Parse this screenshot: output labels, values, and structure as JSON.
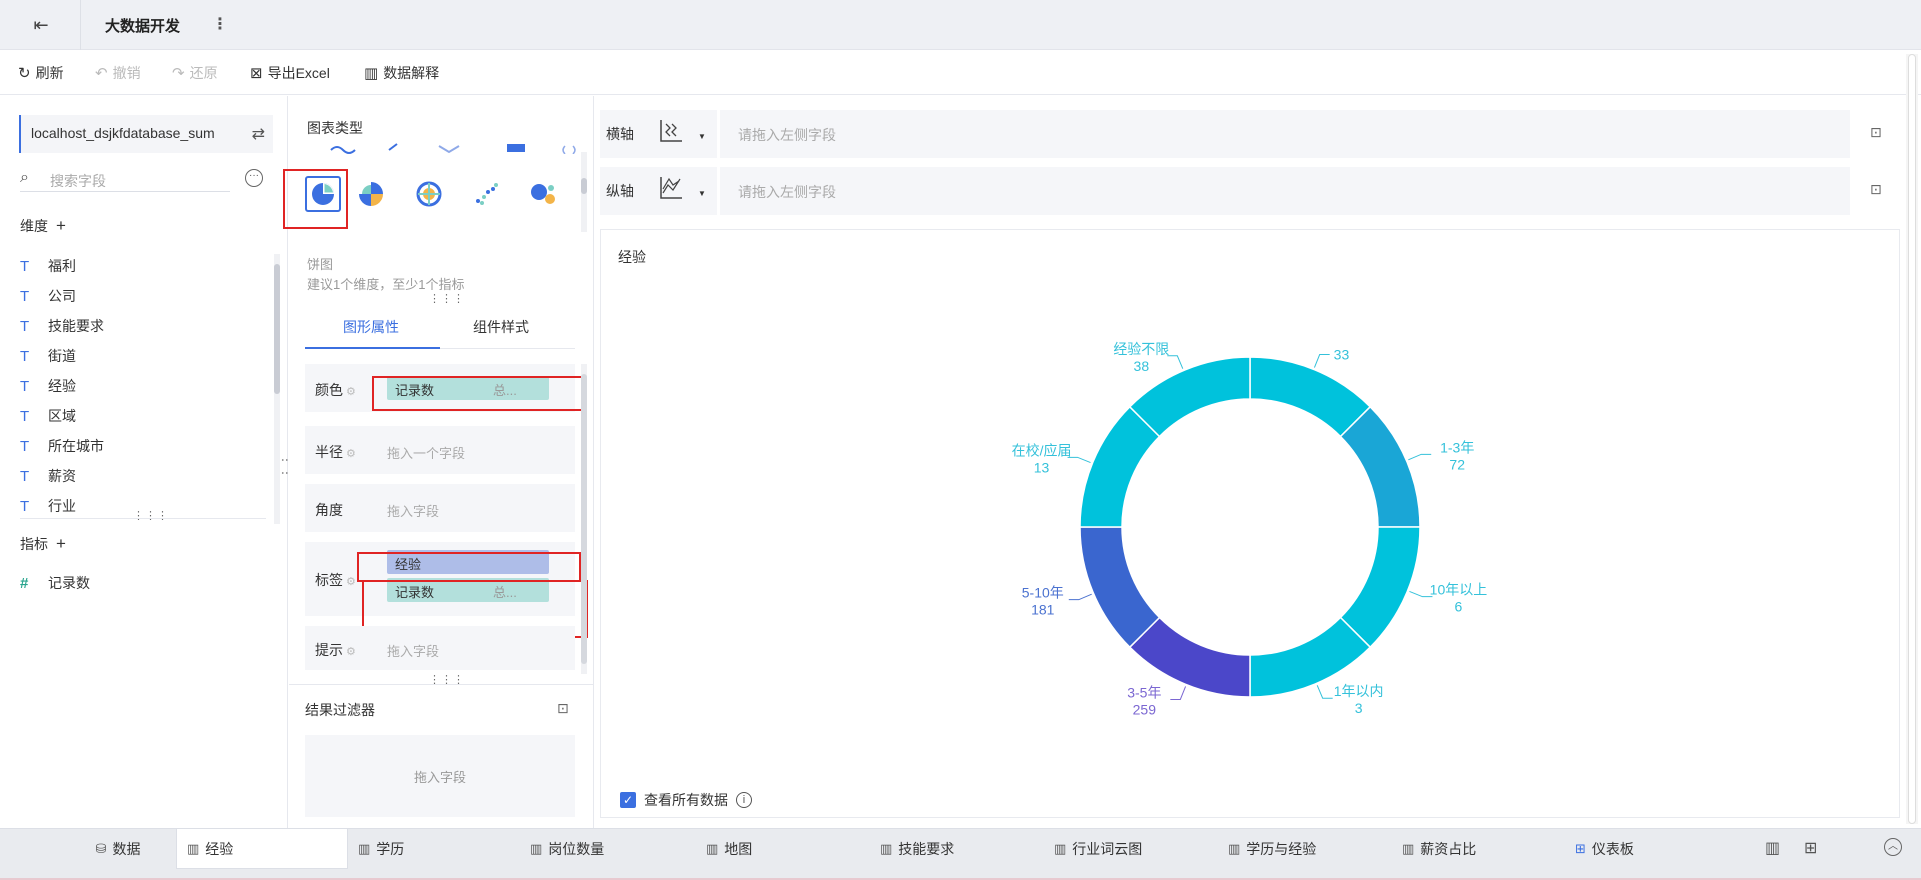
{
  "titlebar": {
    "title": "大数据开发",
    "back_icon": "exit-icon",
    "more_icon": "vertical-dots-icon"
  },
  "toolbar": {
    "refresh": "刷新",
    "undo": "撤销",
    "redo": "还原",
    "export": "导出Excel",
    "explain": "数据解释"
  },
  "left": {
    "dataset_name": "localhost_dsjkfdatabase_sum",
    "search_placeholder": "搜索字段",
    "dimensions_title": "维度",
    "dimensions": [
      "福利",
      "公司",
      "技能要求",
      "街道",
      "经验",
      "区域",
      "所在城市",
      "薪资",
      "行业"
    ],
    "measures_title": "指标",
    "measures": [
      "记录数"
    ]
  },
  "middle": {
    "chart_type_title": "图表类型",
    "chart_name": "饼图",
    "chart_hint": "建议1个维度，至少1个指标",
    "tab_graph": "图形属性",
    "tab_style": "组件样式",
    "color_label": "颜色",
    "color_field": "记录数",
    "color_agg": "总...",
    "radius_label": "半径",
    "radius_placeholder": "拖入一个字段",
    "angle_label": "角度",
    "angle_placeholder": "拖入字段",
    "label_label": "标签",
    "label_field1": "经验",
    "label_field2": "记录数",
    "label_agg": "总...",
    "tip_label": "提示",
    "tip_placeholder": "拖入字段",
    "filter_title": "结果过滤器",
    "filter_placeholder": "拖入字段"
  },
  "axes": {
    "x_label": "横轴",
    "y_label": "纵轴",
    "placeholder": "请拖入左侧字段"
  },
  "chart": {
    "title": "经验",
    "view_all": "查看所有数据"
  },
  "chart_data": {
    "type": "pie",
    "title": "经验",
    "donut": true,
    "categories": [
      "经验不限",
      "1-3年",
      "10年以上",
      "1年以内",
      "3-5年",
      "5-10年",
      "在校/应届"
    ],
    "label_values": [
      "33",
      "72",
      "6",
      "3",
      "259",
      "181",
      "13"
    ],
    "label_names": [
      "",
      "1-3年",
      "10年以上",
      "1年以内",
      "3-5年",
      "5-10年",
      "在校/应届"
    ],
    "top_label": {
      "name": "经验不限",
      "value": "38"
    },
    "segment_colors": [
      "#00c2dc",
      "#1aa6d6",
      "#00c2dc",
      "#00c2dc",
      "#4b47c9",
      "#3a66cf",
      "#00c2dc"
    ],
    "label_colors": [
      "#34c1da",
      "#34c1da",
      "#34c1da",
      "#34c1da",
      "#7b67d2",
      "#4b72d0",
      "#34c1da"
    ]
  },
  "bottom_tabs": [
    "数据",
    "经验",
    "学历",
    "岗位数量",
    "地图",
    "技能要求",
    "行业词云图",
    "学历与经验",
    "薪资占比",
    "仪表板"
  ]
}
